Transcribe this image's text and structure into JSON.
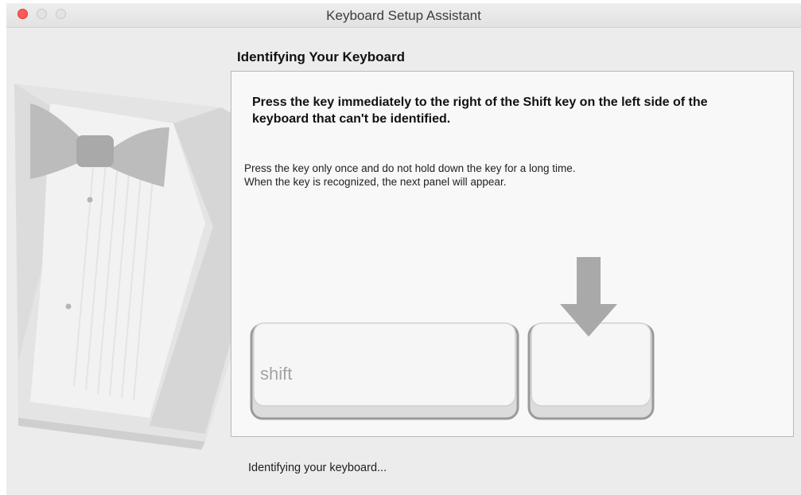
{
  "window": {
    "title": "Keyboard Setup Assistant",
    "buttons": [
      "close-button",
      "minimize-button",
      "zoom-button"
    ],
    "accent_close": "#fc5b57"
  },
  "content": {
    "heading": "Identifying Your Keyboard",
    "instruction": "Press the key immediately to the right of the Shift key on the left side of the keyboard that can't be identified.",
    "subtext_line1": "Press the key only once and do not hold down the key for a long time.",
    "subtext_line2": "When the key is recognized, the next panel will appear.",
    "shift_key_label": "shift",
    "status": "Identifying your keyboard..."
  },
  "icons": {
    "illustration": "tuxedo-bowtie-illustration",
    "indicator": "down-arrow-icon"
  }
}
